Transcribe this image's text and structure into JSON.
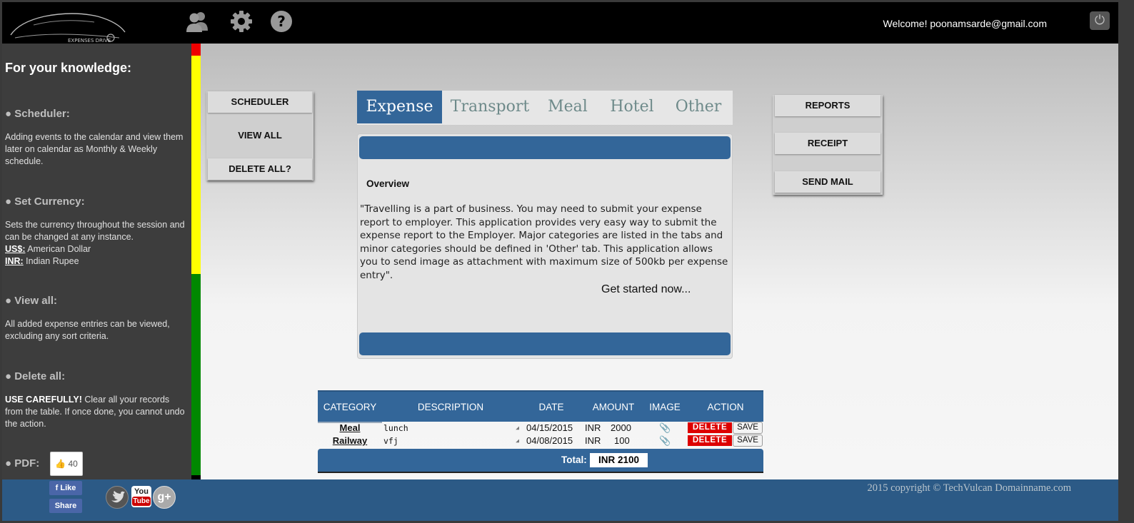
{
  "header": {
    "logo_text": "EXPENSES DRIVE",
    "welcome": "Welcome! poonamsarde@gmail.com",
    "icons": [
      "users-icon",
      "gear-icon",
      "help-icon",
      "power-icon"
    ]
  },
  "sidebar": {
    "title": "For your knowledge:",
    "sections": [
      {
        "heading": "● Scheduler:",
        "text": "Adding events to the calendar and view them later on calendar as Monthly & Weekly schedule."
      },
      {
        "heading": "● Set Currency:",
        "text": "Sets the currency throughout the session and can be changed at any instance.",
        "lines": [
          {
            "code": "US$:",
            "desc": " American Dollar"
          },
          {
            "code": "INR:",
            "desc": " Indian Rupee"
          }
        ]
      },
      {
        "heading": "● View all:",
        "text": "All added expense entries can be viewed, excluding any sort criteria."
      },
      {
        "heading": "● Delete all:",
        "strong": "USE CAREFULLY!",
        "text": " Clear all your records from the table. If once done, you cannot undo the action."
      },
      {
        "heading": "● PDF:"
      }
    ],
    "fb_count": "40"
  },
  "left_panel": {
    "buttons": [
      "SCHEDULER",
      "VIEW ALL",
      "DELETE ALL?"
    ]
  },
  "right_panel": {
    "buttons": [
      "REPORTS",
      "RECEIPT",
      "SEND MAIL"
    ]
  },
  "tabs": [
    "Expense",
    "Transport",
    "Meal",
    "Hotel",
    "Other"
  ],
  "active_tab": "Expense",
  "overview": {
    "title": "Overview",
    "text": "\"Travelling is a part of business. You may need to submit your expense report to employer. This application provides very easy way to submit the expense report to the Employer. Major categories are listed in the tabs and minor categories should be defined in 'Other' tab. This application allows you to send image as attachment with maximum size of 500kb per expense entry\".",
    "cta": "Get started now..."
  },
  "table": {
    "headers": [
      "CATEGORY",
      "DESCRIPTION",
      "DATE",
      "AMOUNT",
      "IMAGE",
      "ACTION"
    ],
    "rows": [
      {
        "category": "Meal",
        "description": "lunch",
        "date": "04/15/2015",
        "currency": "INR",
        "amount": "2000",
        "delete": "DELETE",
        "save": "SAVE"
      },
      {
        "category": "Railway",
        "description": "vfj",
        "date": "04/08/2015",
        "currency": "INR",
        "amount": "100",
        "delete": "DELETE",
        "save": "SAVE"
      }
    ],
    "total_label": "Total:",
    "total_value": "INR 2100"
  },
  "footer": {
    "copyright": "2015 copyright © TechVulcan Domainname.com",
    "like": "Like",
    "share": "Share",
    "youtube_you": "You",
    "youtube_tube": "Tube"
  },
  "colors": {
    "accent": "#336699",
    "header_bg": "#000000",
    "sidebar_bg": "#3d3d3d",
    "delete": "#dd0000"
  }
}
